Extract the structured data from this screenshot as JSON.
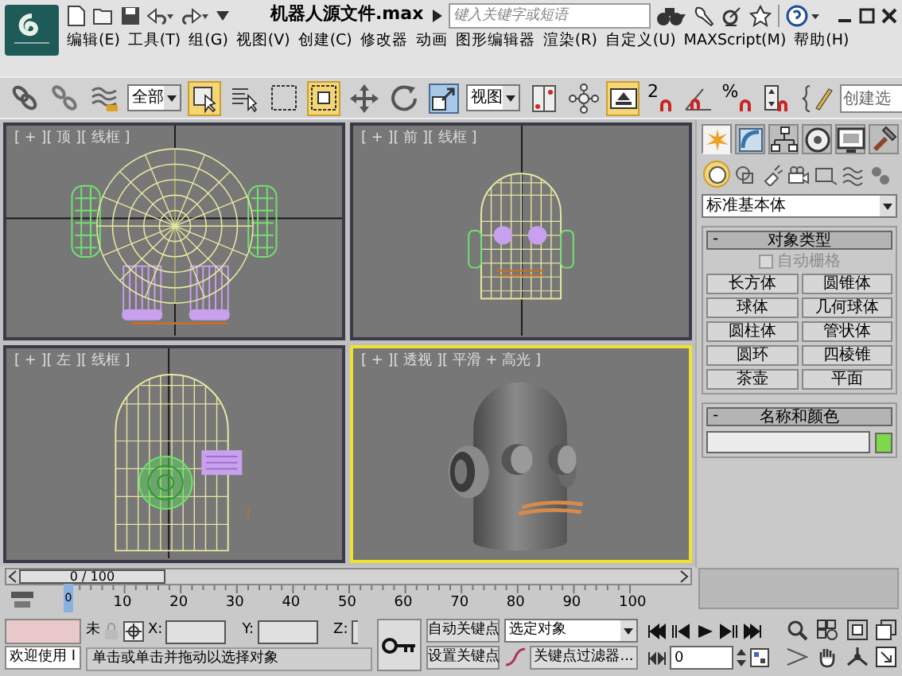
{
  "title_bar": {
    "file_title": "机器人源文件.max",
    "search": {
      "placeholder": "键入关键字或短语"
    }
  },
  "menu": [
    "编辑(E)",
    "工具(T)",
    "组(G)",
    "视图(V)",
    "创建(C)",
    "修改器",
    "动画",
    "图形编辑器",
    "渲染(R)",
    "自定义(U)",
    "MAXScript(M)",
    "帮助(H)"
  ],
  "toolbar": [
    {
      "kind": "link",
      "active": false
    },
    {
      "kind": "unlink",
      "active": false
    },
    {
      "kind": "bind",
      "active": false
    },
    {
      "kind": "dropdown",
      "value": "全部"
    },
    {
      "kind": "select",
      "active": true
    },
    {
      "kind": "select-by-name",
      "active": false
    },
    {
      "kind": "region",
      "active": false
    },
    {
      "kind": "crossing",
      "active": true
    },
    {
      "kind": "move",
      "active": false
    },
    {
      "kind": "rotate",
      "active": false
    },
    {
      "kind": "scale",
      "active": false
    },
    {
      "kind": "dropdown",
      "value": "视图"
    },
    {
      "kind": "pivot",
      "active": false
    },
    {
      "kind": "schematic",
      "active": false
    },
    {
      "kind": "manipulate",
      "active": true
    },
    {
      "kind": "snap",
      "label": "2",
      "active": false
    },
    {
      "kind": "angle-snap",
      "active": false
    },
    {
      "kind": "snap",
      "label": "%",
      "active": false
    },
    {
      "kind": "spinner-snap",
      "active": false
    },
    {
      "kind": "edit-named",
      "active": false
    },
    {
      "kind": "field",
      "value": "创建选"
    }
  ],
  "viewports": [
    {
      "kind": "top",
      "label": "[ + ][ 顶 ][ 线框 ]",
      "selected": false
    },
    {
      "kind": "front",
      "label": "[ + ][ 前 ][ 线框 ]",
      "selected": false
    },
    {
      "kind": "left",
      "label": "[ + ][ 左 ][ 线框 ]",
      "selected": false
    },
    {
      "kind": "perspective",
      "label": "[ + ][ 透视 ][ 平滑 + 高光 ]",
      "selected": true
    }
  ],
  "command_panel": {
    "tabs": [
      {
        "kind": "create",
        "selected": true
      },
      {
        "kind": "modify",
        "selected": false
      },
      {
        "kind": "hierarchy",
        "selected": false
      },
      {
        "kind": "motion",
        "selected": false
      },
      {
        "kind": "display",
        "selected": false
      },
      {
        "kind": "utilities",
        "selected": false
      }
    ],
    "categories": [
      {
        "kind": "geometry",
        "selected": true
      },
      {
        "kind": "shapes",
        "selected": false
      },
      {
        "kind": "lights",
        "selected": false
      },
      {
        "kind": "cameras",
        "selected": false
      },
      {
        "kind": "helpers",
        "selected": false
      },
      {
        "kind": "spacewarps",
        "selected": false
      },
      {
        "kind": "systems",
        "selected": false
      }
    ],
    "type_dropdown": "标准基本体",
    "object_type": {
      "title": "对象类型",
      "collapse": "-",
      "autogrid": {
        "label": "自动栅格",
        "checked": false,
        "disabled": true
      },
      "buttons": [
        "长方体",
        "圆锥体",
        "球体",
        "几何球体",
        "圆柱体",
        "管状体",
        "圆环",
        "四棱锥",
        "茶壶",
        "平面"
      ]
    },
    "name_color": {
      "title": "名称和颜色",
      "collapse": "-",
      "color": "#7fd84a"
    }
  },
  "time_slider": {
    "label": "0 / 100",
    "level": 0
  },
  "track_bar": {
    "ticks": [
      "0",
      "10",
      "20",
      "30",
      "40",
      "50",
      "60",
      "70",
      "80",
      "90",
      "100"
    ]
  },
  "status": {
    "listener": "欢迎使用 I",
    "lock_label": "未",
    "x_label": "X:",
    "y_label": "Y:",
    "z_label": "Z:",
    "prompt": "单击或单击并拖动以选择对象"
  },
  "animation": {
    "auto_key": "自动关键点",
    "set_key": "设置关键点",
    "key_mode": "选定对象",
    "key_filters": "关键点过滤器...",
    "frame": "0"
  }
}
